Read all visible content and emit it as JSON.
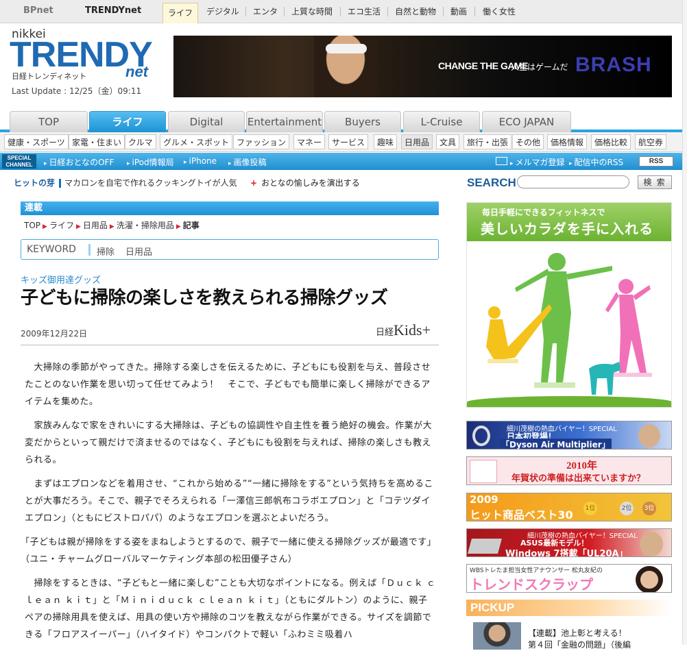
{
  "topnav": {
    "sites": [
      "BPnet",
      "TRENDYnet"
    ],
    "categories": [
      "ライフ",
      "デジタル",
      "エンタ",
      "上質な時間",
      "エコ生活",
      "自然と動物",
      "動画",
      "働く女性"
    ]
  },
  "masthead": {
    "nikkei": "nikkei",
    "trendy": "TRENDY",
    "net": "net",
    "jp": "日経トレンディネット",
    "last_update": "Last Update : 12/25（金）09:11"
  },
  "banner": {
    "tagline": "CHANGE THE GAME",
    "tagline_jp": "人生はゲームだ",
    "brand": "BRASH"
  },
  "tabs": [
    "TOP",
    "ライフ",
    "Digital",
    "Entertainment",
    "Buyers",
    "L-Cruise",
    "ECO JAPAN"
  ],
  "subnav": [
    "健康・スポーツ",
    "家電・住まい",
    "クルマ",
    "グルメ・スポット",
    "ファッション",
    "マネー",
    "サービス",
    "趣味",
    "日用品",
    "文具",
    "旅行・出張",
    "その他",
    "価格情報",
    "価格比較",
    "航空券"
  ],
  "special": {
    "label1": "SPECIAL",
    "label2": "CHANNEL",
    "links": [
      "日経おとなのOFF",
      "iPod情報局",
      "iPhone",
      "画像投稿"
    ],
    "right_links": [
      "メルマガ登録",
      "配信中のRSS"
    ],
    "rss": "RSS"
  },
  "ticker": {
    "head": "ヒットの芽",
    "text": "マカロンを自宅で作れるクッキングトイが人気",
    "plus": "+",
    "text2": "おとなの愉しみを演出する"
  },
  "section": "連載",
  "breadcrumb": [
    "TOP",
    "ライフ",
    "日用品",
    "洗濯・掃除用品",
    "記事"
  ],
  "keyword": {
    "label": "KEYWORD",
    "words": [
      "掃除",
      "日用品"
    ]
  },
  "article": {
    "series": "キッズ御用達グッズ",
    "title": "子どもに掃除の楽しさを教えられる掃除グッズ",
    "date": "2009年12月22日",
    "source_prefix": "日経",
    "source": "Kids+",
    "paragraphs": [
      "　大掃除の季節がやってきた。掃除する楽しさを伝えるために、子どもにも役割を与え、普段させたことのない作業を思い切って任せてみよう！　そこで、子どもでも簡単に楽しく掃除ができるアイテムを集めた。",
      "　家族みんなで家をきれいにする大掃除は、子どもの協調性や自主性を養う絶好の機会。作業が大変だからといって親だけで済ませるのではなく、子どもにも役割を与えれば、掃除の楽しさも教えられる。",
      "　まずはエプロンなどを着用させ、“これから始める”“一緒に掃除をする”という気持ちを高めることが大事だろう。そこで、親子でそろえられる「一澤信三郎帆布コラボエプロン」と「コテツダイエプロン」（ともにビストロパパ）のようなエプロンを選ぶとよいだろう。",
      "「子どもは親が掃除をする姿をまねしようとするので、親子で一緒に使える掃除グッズが最適です」（ユニ・チャームグローバルマーケティング本部の松田優子さん）",
      "　掃除をするときは、“子どもと一緒に楽しむ”ことも大切なポイントになる。例えば「Ｄｕｃｋ ｃｌｅａｎ ｋｉｔ」と「Ｍｉｎｉｄｕｃｋ ｃｌｅａｎ ｋｉｔ」（ともにダルトン）のように、親子ペアの掃除用具を使えば、用具の使い方や掃除のコツを教えながら作業ができる。サイズを調節できる「フロアスイーパー」（ハイタイド）やコンパクトで軽い「ふわミミ吸着ハ"
    ]
  },
  "sidebar": {
    "search_label": "SEARCH",
    "search_placeholder": "",
    "search_button": "検 索",
    "fitness": {
      "line1": "毎日手軽にできるフィットネスで",
      "line2": "美しいカラダを手に入れる"
    },
    "banners": [
      {
        "a": "細川茂樹の熱血バイヤー！SPECIAL",
        "b": "日本初登場！",
        "c": "「Dyson Air Multiplier」"
      },
      {
        "a": "2010年",
        "b": "年賀状の準備は出来ていますか？"
      },
      {
        "a": "2009",
        "b": "ヒット商品ベスト30",
        "c": "1位",
        "d": "2位",
        "e": "3位"
      },
      {
        "a": "細川茂樹の熱血バイヤー！SPECIAL",
        "b": "ASUS最新モデル！",
        "c": "Windows 7搭載「UL20A」"
      },
      {
        "a": "WBSトレたま担当女性アナウンサー 松丸友紀の",
        "b": "トレンドスクラップ"
      }
    ],
    "pickup": "PICKUP",
    "pick_text1": "【連載】池上彰と考える！",
    "pick_text2": "第４回「金融の問題」（後編"
  },
  "colors": {
    "accent_blue": "#29a3e3",
    "logo_blue": "#1e6ab3",
    "fitness_green": "#6cb332",
    "pickup_orange": "#f8b25a"
  }
}
